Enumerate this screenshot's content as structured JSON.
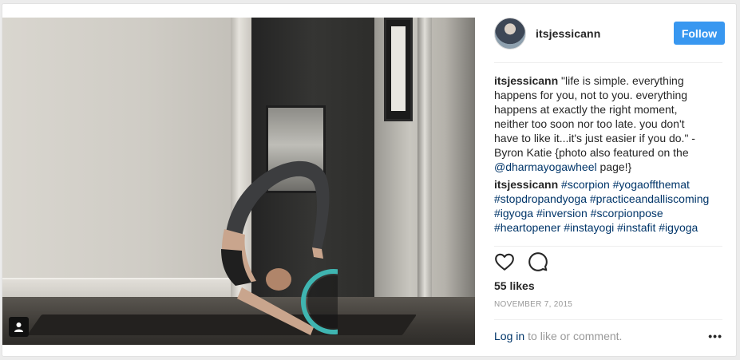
{
  "post": {
    "username": "itsjessicann",
    "follow_label": "Follow",
    "caption": {
      "author": "itsjessicann",
      "text": "\"life is simple. everything happens for you, not to you. everything happens at exactly the right moment, neither too soon nor too late. you don't have to like it...it's just easier if you do.\" - Byron Katie {photo also featured on the ",
      "mention": "@dharmayogawheel",
      "text_after": " page!}"
    },
    "hashtag_comment": {
      "author": "itsjessicann",
      "tags": [
        "#scorpion",
        "#yogaoffthemat",
        "#stopdropandyoga",
        "#practiceandalliscoming",
        "#igyoga",
        "#inversion",
        "#scorpionpose",
        "#heartopener",
        "#instayogi",
        "#instafit",
        "#igyoga"
      ]
    },
    "likes": "55 likes",
    "date": "NOVEMBER 7, 2015",
    "login_link": "Log in",
    "login_text": "to like or comment.",
    "more_options": "•••"
  },
  "icons": {
    "like": "heart-icon",
    "comment": "comment-icon",
    "user_tag": "person-icon"
  },
  "colors": {
    "follow_button": "#3897f0",
    "link": "#003569",
    "muted": "#999999"
  }
}
